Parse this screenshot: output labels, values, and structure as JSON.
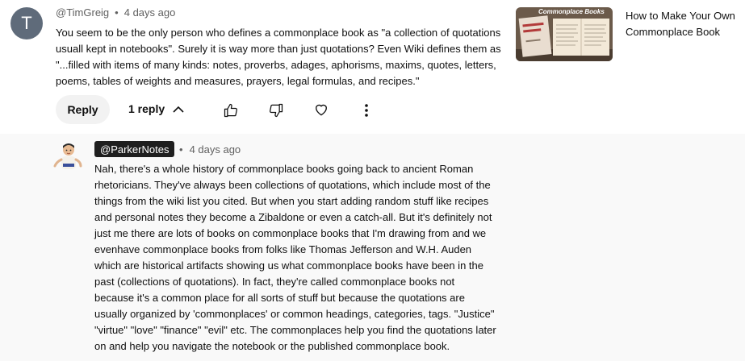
{
  "comment": {
    "avatar_letter": "T",
    "author": "@TimGreig",
    "separator": "•",
    "time": "4 days ago",
    "lines": [
      "You seem to be the only person who defines a commonplace book as \"a collection of quotations",
      "usuall kept in notebooks\". Surely it is way more than just quotations? Even Wiki defines them as",
      "\"...filled with items of many kinds: notes, proverbs, adages, aphorisms, maxims, quotes, letters,",
      "poems, tables of weights and measures, prayers, legal formulas, and recipes.\""
    ],
    "reply_label": "Reply",
    "replies_label": "1 reply"
  },
  "related_video": {
    "title": "How to Make Your Own Commonplace Book",
    "thumb_text": "Commonplace Books",
    "thumb_bg": "#6b5a4a",
    "thumb_accent": "#f3e9d8"
  },
  "reply": {
    "author": "@ParkerNotes",
    "separator": "•",
    "time": "4 days ago",
    "lines": [
      "Nah, there's a whole history of commonplace books going back to ancient Roman",
      "rhetoricians. They've always been collections of quotations, which include most of the",
      "things from the wiki list you cited. But when you start adding random stuff like recipes",
      "and personal notes they become a Zibaldone or even a catch-all.  But it's definitely not",
      "just me there are lots of books on commonplace books that I'm drawing from and we",
      "evenhave commonplace books from folks like Thomas Jefferson and W.H. Auden",
      "which are historical artifacts showing us what commonplace books have been in the",
      "past (collections of quotations). In fact, they're called commonplace books not",
      "because it's a common place for all sorts of stuff but because the quotations are",
      "usually organized by 'commonplaces' or common headings, categories, tags. \"Justice\"",
      "\"virtue\" \"love\" \"finance\" \"evil\" etc. The commonplaces help you find the quotations later",
      "on and help you navigate the notebook or the published commonplace book."
    ]
  },
  "colors": {
    "avatar_bg": "#5f6b7a",
    "chip_bg": "#1f1f1f",
    "reply_section_bg": "#f9f9f9",
    "meta_text": "#606060"
  }
}
